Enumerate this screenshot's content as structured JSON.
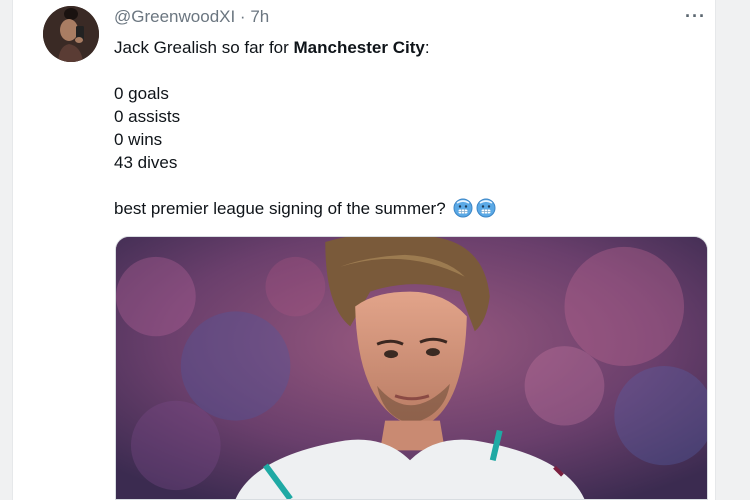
{
  "tweet": {
    "handle_time": "@GreenwoodXI · 7h",
    "more_icon": "···",
    "text": {
      "line1_prefix": "Jack Grealish so far for ",
      "line1_bold": "Manchester City",
      "line1_suffix": ":",
      "stats": [
        "0 goals",
        "0 assists",
        "0 wins",
        "43 dives"
      ],
      "closing": "best premier league signing of the summer?",
      "emojis": [
        "cold-face-emoji",
        "cold-face-emoji"
      ]
    }
  },
  "colors": {
    "text": "#0f1419",
    "muted": "#6b7680",
    "emoji_blue": "#5aa9e6"
  }
}
